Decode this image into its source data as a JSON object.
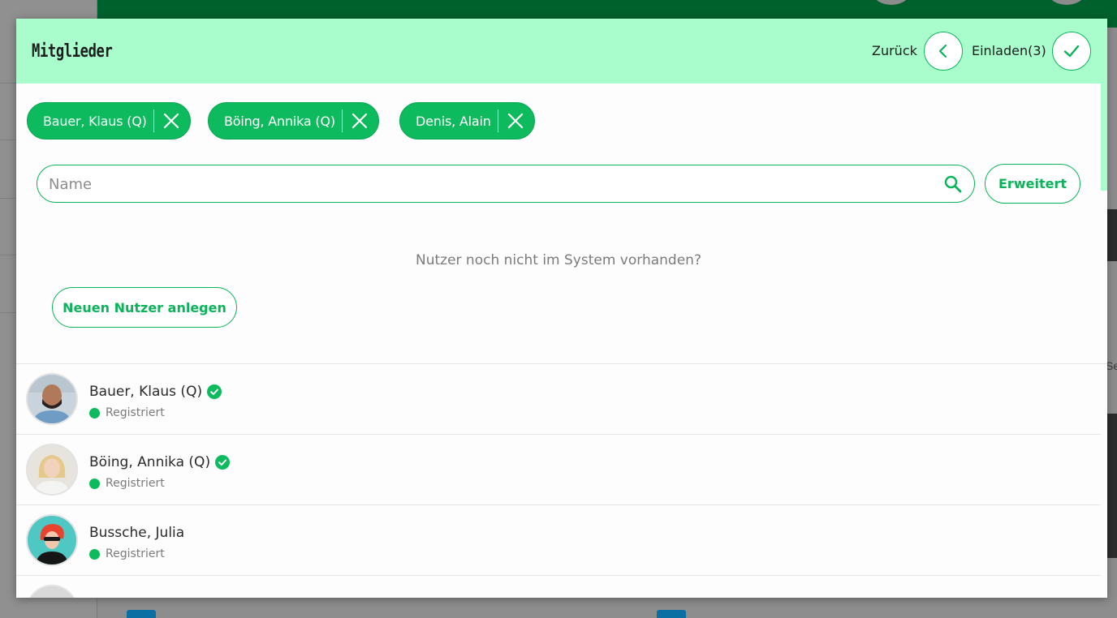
{
  "header": {
    "title": "Mitglieder",
    "back_label": "Zurück",
    "invite_label": "Einladen(3)"
  },
  "chips": [
    {
      "label": "Bauer, Klaus (Q)"
    },
    {
      "label": "Böing, Annika (Q)"
    },
    {
      "label": "Denis, Alain"
    }
  ],
  "search": {
    "placeholder": "Name",
    "value": "",
    "advanced_label": "Erweitert"
  },
  "hint": "Nutzer noch nicht im System vorhanden?",
  "new_user_label": "Neuen Nutzer anlegen",
  "members": [
    {
      "name": "Bauer, Klaus (Q)",
      "status": "Registriert",
      "verified": true
    },
    {
      "name": "Böing, Annika (Q)",
      "status": "Registriert",
      "verified": true
    },
    {
      "name": "Bussche, Julia",
      "status": "Registriert",
      "verified": false
    }
  ],
  "background": {
    "partial_text": "Se"
  },
  "colors": {
    "accent": "#0bb35b",
    "chip_bg": "#0dbb5e",
    "header_bg": "#a9fdcc",
    "topbar": "#00612c"
  }
}
